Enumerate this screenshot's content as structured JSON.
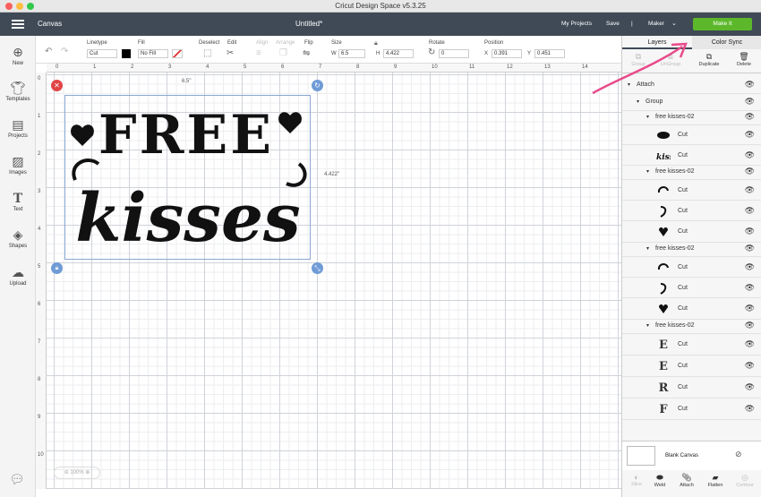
{
  "window": {
    "title": "Cricut Design Space  v5.3.25"
  },
  "appbar": {
    "section": "Canvas",
    "doc_title": "Untitled*",
    "my_projects": "My Projects",
    "save": "Save",
    "divider": "|",
    "machine": "Maker",
    "make_it": "Make It"
  },
  "toolbar": {
    "labels": {
      "linetype": "Linetype",
      "fill": "Fill",
      "deselect": "Deselect",
      "edit": "Edit",
      "align": "Align",
      "arrange": "Arrange",
      "flip": "Flip",
      "size": "Size",
      "rotate": "Rotate",
      "position": "Position"
    },
    "linetype_value": "Cut",
    "fill_value": "No Fill",
    "w_label": "W",
    "w_value": "6.5",
    "h_label": "H",
    "h_value": "4.422",
    "rotate_value": "0",
    "x_label": "X",
    "x_value": "0.391",
    "y_label": "Y",
    "y_value": "0.451"
  },
  "nav": [
    {
      "label": "New",
      "icon": "plus-circle-icon"
    },
    {
      "label": "Templates",
      "icon": "shirt-icon"
    },
    {
      "label": "Projects",
      "icon": "projects-icon"
    },
    {
      "label": "Images",
      "icon": "image-icon"
    },
    {
      "label": "Text",
      "icon": "text-icon"
    },
    {
      "label": "Shapes",
      "icon": "shapes-icon"
    },
    {
      "label": "Upload",
      "icon": "upload-icon"
    }
  ],
  "ruler": {
    "h": [
      "0",
      "1",
      "2",
      "3",
      "4",
      "5",
      "6",
      "7",
      "8",
      "9",
      "10",
      "11",
      "12",
      "13",
      "14"
    ],
    "v": [
      "0",
      "1",
      "2",
      "3",
      "4",
      "5",
      "6",
      "7",
      "8",
      "9",
      "10"
    ]
  },
  "canvas": {
    "width_label": "6.5\"",
    "height_label": "4.422\"",
    "zoom": "100%",
    "design_line1": "FREE",
    "design_line2": "kisses"
  },
  "panel": {
    "tabs": {
      "layers": "Layers",
      "color_sync": "Color Sync"
    },
    "actions": {
      "group": "Group",
      "ungroup": "UnGroup",
      "duplicate": "Duplicate",
      "delete": "Delete"
    },
    "attach": "Attach",
    "group": "Group",
    "groups": [
      {
        "name": "free kisses-02",
        "items": [
          {
            "thumb": "blob",
            "label": "Cut"
          },
          {
            "thumb": "kisses",
            "label": "Cut"
          }
        ]
      },
      {
        "name": "free kisses-02",
        "items": [
          {
            "thumb": "swirl",
            "label": "Cut"
          },
          {
            "thumb": "hook",
            "label": "Cut"
          },
          {
            "thumb": "heart",
            "label": "Cut"
          }
        ]
      },
      {
        "name": "free kisses-02",
        "items": [
          {
            "thumb": "swirl",
            "label": "Cut"
          },
          {
            "thumb": "hook",
            "label": "Cut"
          },
          {
            "thumb": "heart",
            "label": "Cut"
          }
        ]
      },
      {
        "name": "free kisses-02",
        "items": [
          {
            "thumb": "E",
            "label": "Cut"
          },
          {
            "thumb": "E",
            "label": "Cut"
          },
          {
            "thumb": "R",
            "label": "Cut"
          },
          {
            "thumb": "F",
            "label": "Cut"
          }
        ]
      }
    ],
    "blank_canvas": "Blank Canvas",
    "bottom": {
      "slice": "Slice",
      "weld": "Weld",
      "attach": "Attach",
      "flatten": "Flatten",
      "contour": "Contour"
    }
  },
  "colors": {
    "appbar": "#3f4a56",
    "make_it": "#5cb82a",
    "annotation_arrow": "#e84b8a"
  }
}
